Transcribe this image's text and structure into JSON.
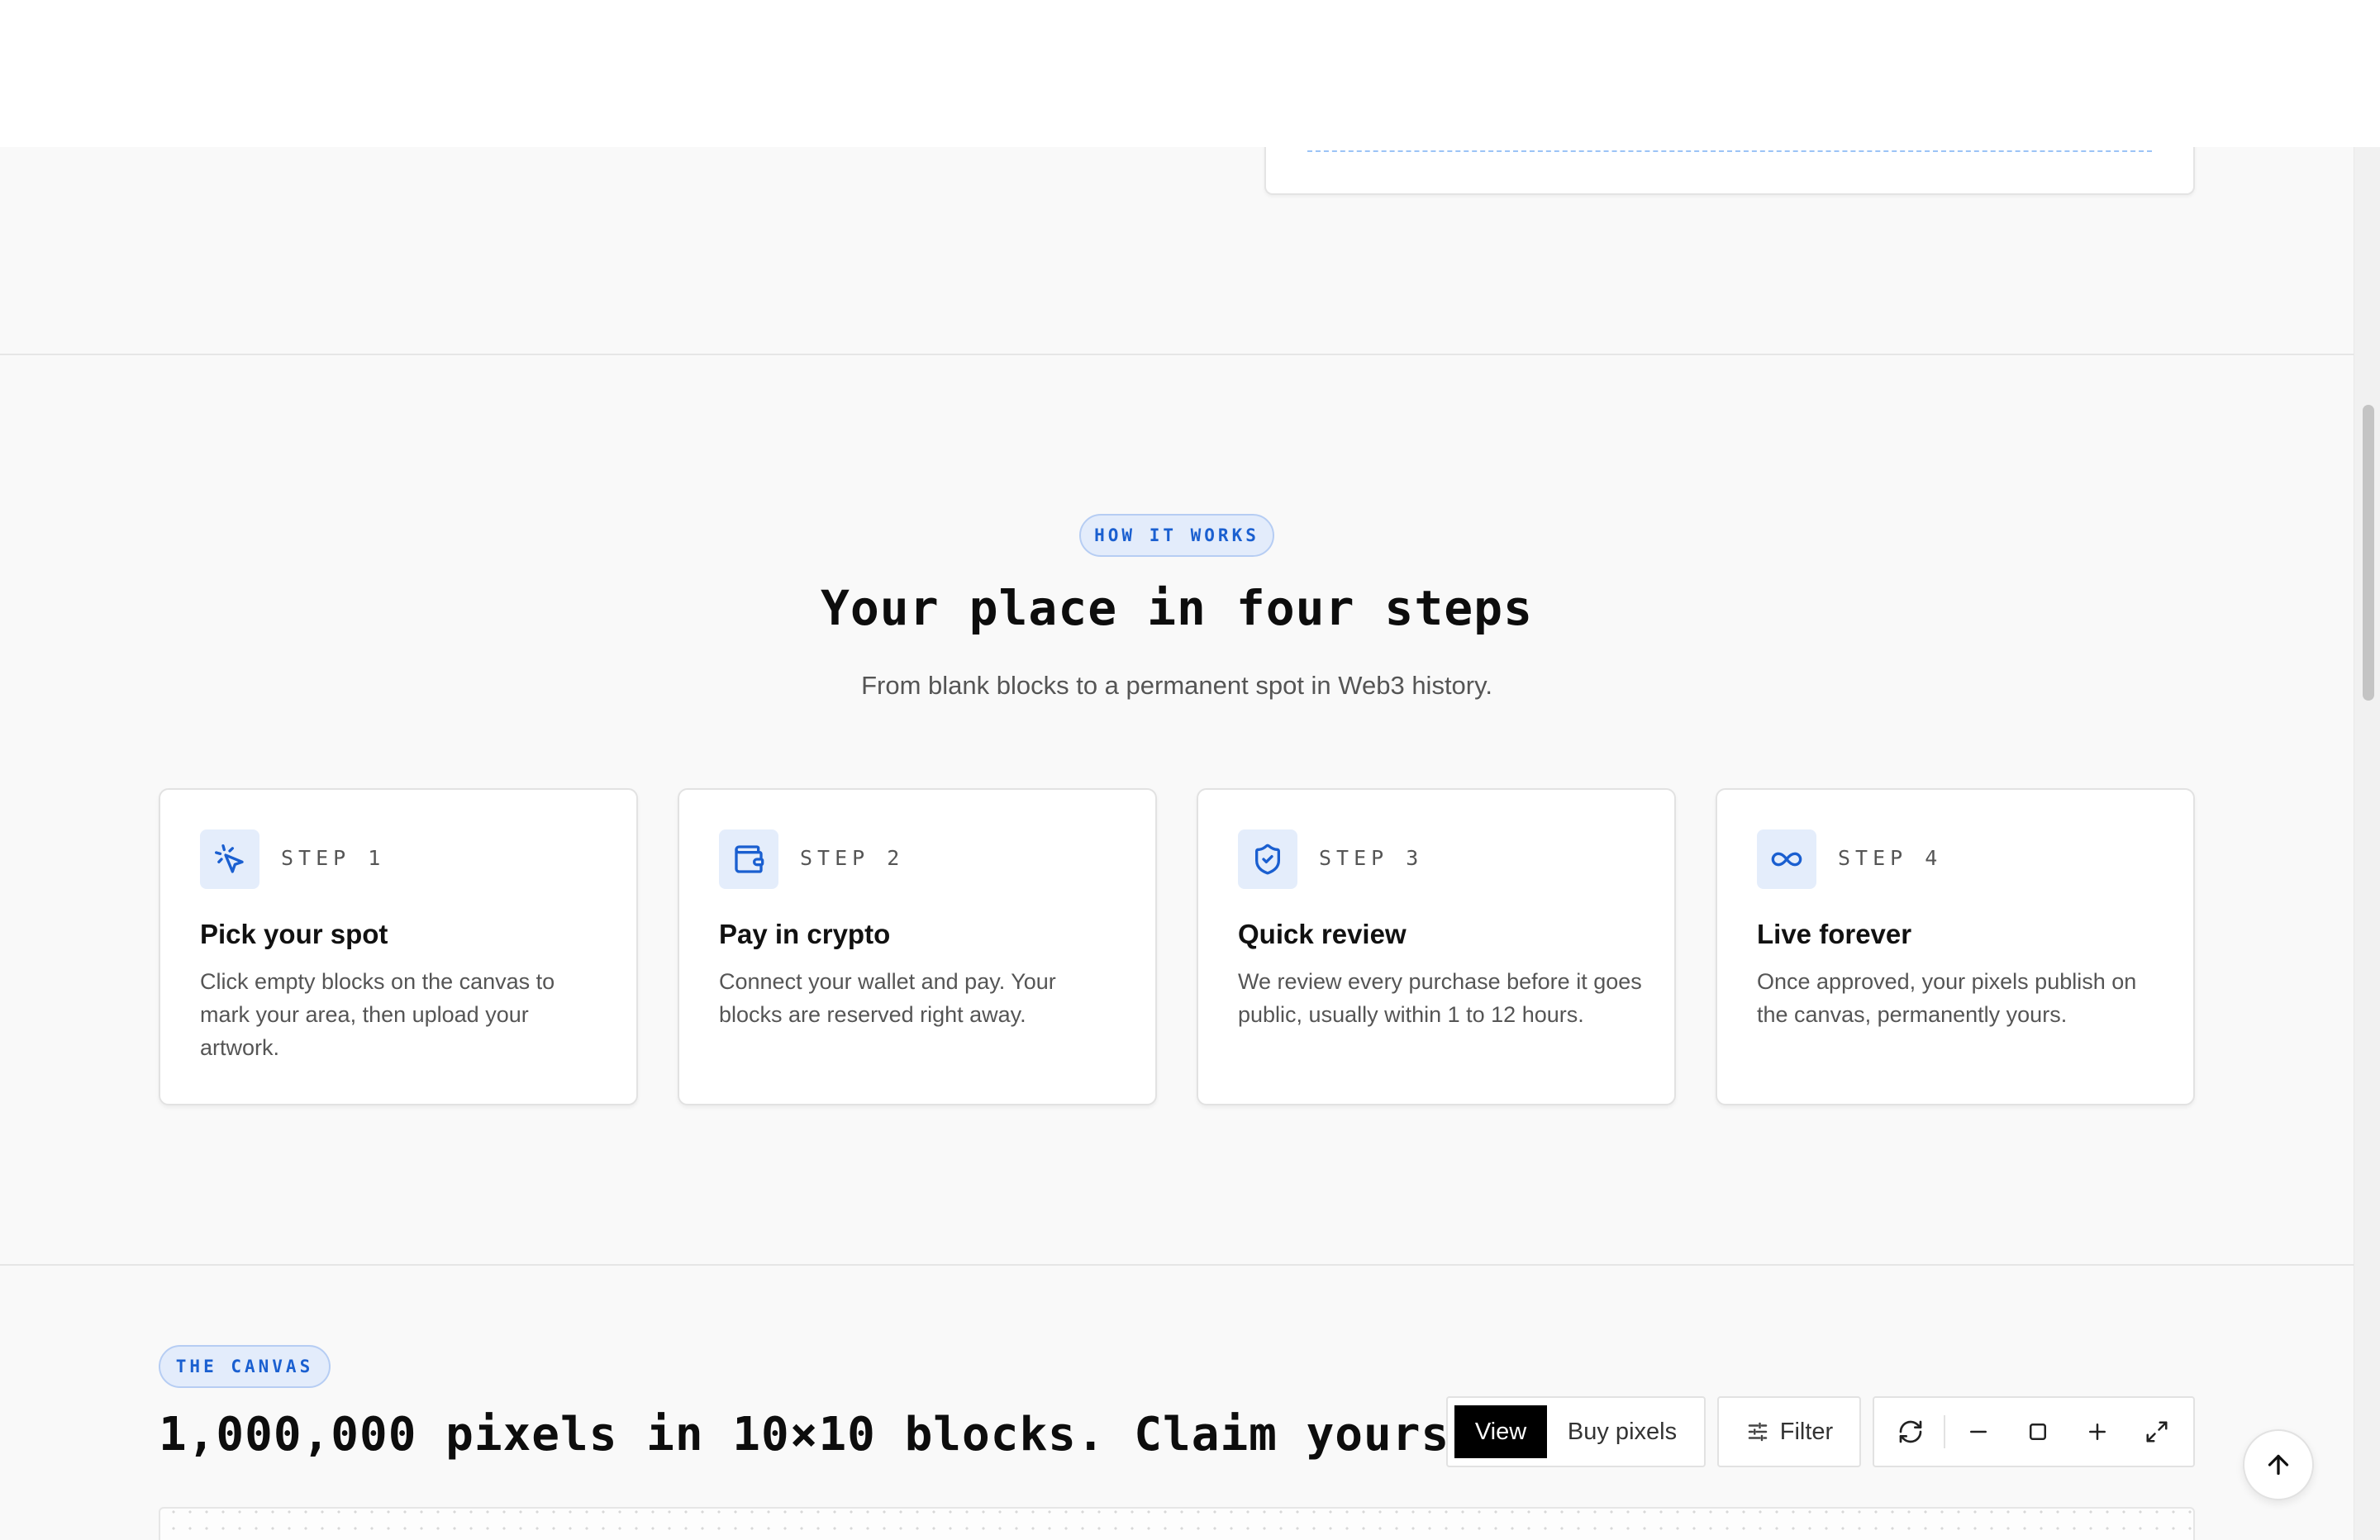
{
  "how_it_works": {
    "badge": "HOW IT WORKS",
    "title": "Your place in four steps",
    "subtitle": "From blank blocks to a permanent spot in Web3 history.",
    "steps": [
      {
        "icon": "cursor-click-icon",
        "label": "STEP 1",
        "title": "Pick your spot",
        "description": "Click empty blocks on the canvas to mark your area, then upload your artwork."
      },
      {
        "icon": "wallet-icon",
        "label": "STEP 2",
        "title": "Pay in crypto",
        "description": "Connect your wallet and pay. Your blocks are reserved right away."
      },
      {
        "icon": "shield-check-icon",
        "label": "STEP 3",
        "title": "Quick review",
        "description": "We review every purchase before it goes public, usually within 1 to 12 hours."
      },
      {
        "icon": "infinity-icon",
        "label": "STEP 4",
        "title": "Live forever",
        "description": "Once approved, your pixels publish on the canvas, permanently yours."
      }
    ]
  },
  "canvas": {
    "badge": "THE CANVAS",
    "title": "1,000,000 pixels in 10×10 blocks. Claim yours.",
    "mode_toggle": {
      "active": "View",
      "options": [
        "View",
        "Buy pixels"
      ]
    },
    "filter_label": "Filter",
    "controls": [
      "refresh-icon",
      "zoom-out-icon",
      "fit-view-icon",
      "zoom-in-icon",
      "fullscreen-icon"
    ]
  },
  "colors": {
    "accent": "#1a5fd0",
    "accent_bg": "#e4edfb",
    "page_bg": "#f9f9f9"
  }
}
